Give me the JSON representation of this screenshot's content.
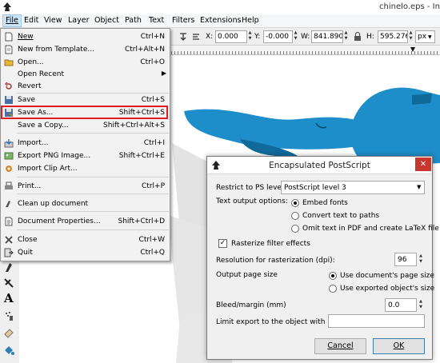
{
  "window": {
    "title": "chinelo.eps - In"
  },
  "menubar": {
    "items": [
      "File",
      "Edit",
      "View",
      "Layer",
      "Object",
      "Path",
      "Text",
      "Filters",
      "Extensions",
      "Help"
    ]
  },
  "toolbar": {
    "x_label": "X:",
    "x_value": "0.000",
    "y_label": "Y:",
    "y_value": "-0.000",
    "w_label": "W:",
    "w_value": "841.890",
    "h_label": "H:",
    "h_value": "595.276",
    "unit": "px"
  },
  "file_menu": {
    "items": [
      {
        "label": "New",
        "shortcut": "Ctrl+N",
        "icon": "new-document-icon"
      },
      {
        "label": "New from Template...",
        "shortcut": "Ctrl+Alt+N",
        "icon": "template-icon"
      },
      {
        "label": "Open...",
        "shortcut": "Ctrl+O",
        "icon": "open-folder-icon"
      },
      {
        "label": "Open Recent",
        "shortcut": "",
        "icon": ""
      },
      {
        "label": "Revert",
        "shortcut": "",
        "icon": "revert-icon"
      },
      {
        "label": "Save",
        "shortcut": "Ctrl+S",
        "icon": "save-icon"
      },
      {
        "label": "Save As...",
        "shortcut": "Shift+Ctrl+S",
        "icon": "save-as-icon"
      },
      {
        "label": "Save a Copy...",
        "shortcut": "Shift+Ctrl+Alt+S",
        "icon": ""
      },
      {
        "label": "Import...",
        "shortcut": "Ctrl+I",
        "icon": "import-icon"
      },
      {
        "label": "Export PNG Image...",
        "shortcut": "Shift+Ctrl+E",
        "icon": "export-png-icon"
      },
      {
        "label": "Import Clip Art...",
        "shortcut": "",
        "icon": "clip-art-icon"
      },
      {
        "label": "Print...",
        "shortcut": "Ctrl+P",
        "icon": "print-icon"
      },
      {
        "label": "Clean up document",
        "shortcut": "",
        "icon": "clean-up-icon"
      },
      {
        "label": "Document Properties...",
        "shortcut": "Shift+Ctrl+D",
        "icon": "document-properties-icon"
      },
      {
        "label": "Close",
        "shortcut": "Ctrl+W",
        "icon": "close-icon"
      },
      {
        "label": "Quit",
        "shortcut": "Ctrl+Q",
        "icon": "quit-icon"
      }
    ]
  },
  "dialog": {
    "title": "Encapsulated PostScript",
    "restrict_label": "Restrict to PS level:",
    "restrict_value": "PostScript level 3",
    "text_output_label": "Text output options:",
    "text_output_options": [
      "Embed fonts",
      "Convert text to paths",
      "Omit text in PDF and create LaTeX file"
    ],
    "rasterize_label": "Rasterize filter effects",
    "rasterize_checked": true,
    "resolution_label": "Resolution for rasterization (dpi):",
    "resolution_value": "96",
    "page_size_label": "Output page size",
    "page_size_options": [
      "Use document's page size",
      "Use exported object's size"
    ],
    "bleed_label": "Bleed/margin (mm)",
    "bleed_value": "0.0",
    "limit_label": "Limit export to the object with ID:",
    "limit_value": "",
    "cancel_label": "Cancel",
    "ok_label": "OK"
  },
  "colors": {
    "shape_blue": "#1d8ec9",
    "shape_dark": "#0f6a9a",
    "highlight_red": "#e31c23",
    "close_red": "#c7372e"
  }
}
